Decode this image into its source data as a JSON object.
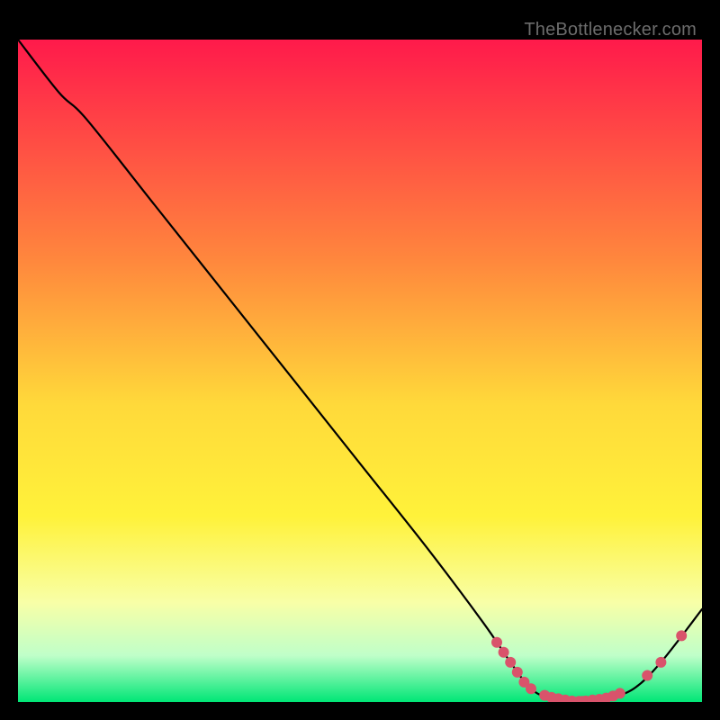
{
  "attribution": {
    "text": "TheBottlenecker.com"
  },
  "chart_data": {
    "type": "line",
    "title": "",
    "xlabel": "",
    "ylabel": "",
    "xlim": [
      0,
      100
    ],
    "ylim": [
      0,
      100
    ],
    "background_gradient": {
      "stops": [
        {
          "offset": 0,
          "color": "#ff1a4b"
        },
        {
          "offset": 0.33,
          "color": "#ff863d"
        },
        {
          "offset": 0.55,
          "color": "#ffd93a"
        },
        {
          "offset": 0.72,
          "color": "#fff23a"
        },
        {
          "offset": 0.85,
          "color": "#f8ffa7"
        },
        {
          "offset": 0.93,
          "color": "#bfffc9"
        },
        {
          "offset": 1.0,
          "color": "#00e676"
        }
      ]
    },
    "curve": [
      {
        "x": 0,
        "y": 100
      },
      {
        "x": 6,
        "y": 92
      },
      {
        "x": 10,
        "y": 88
      },
      {
        "x": 20,
        "y": 75
      },
      {
        "x": 30,
        "y": 62
      },
      {
        "x": 40,
        "y": 49
      },
      {
        "x": 50,
        "y": 36
      },
      {
        "x": 60,
        "y": 23
      },
      {
        "x": 68,
        "y": 12
      },
      {
        "x": 72,
        "y": 6
      },
      {
        "x": 75,
        "y": 2
      },
      {
        "x": 78,
        "y": 0.5
      },
      {
        "x": 82,
        "y": 0
      },
      {
        "x": 86,
        "y": 0.5
      },
      {
        "x": 90,
        "y": 2
      },
      {
        "x": 94,
        "y": 6
      },
      {
        "x": 100,
        "y": 14
      }
    ],
    "markers": [
      {
        "x": 70,
        "y": 9
      },
      {
        "x": 71,
        "y": 7.5
      },
      {
        "x": 72,
        "y": 6
      },
      {
        "x": 73,
        "y": 4.5
      },
      {
        "x": 74,
        "y": 3
      },
      {
        "x": 75,
        "y": 2
      },
      {
        "x": 77,
        "y": 1
      },
      {
        "x": 78,
        "y": 0.7
      },
      {
        "x": 79,
        "y": 0.5
      },
      {
        "x": 80,
        "y": 0.3
      },
      {
        "x": 81,
        "y": 0.15
      },
      {
        "x": 82,
        "y": 0.1
      },
      {
        "x": 82.5,
        "y": 0.1
      },
      {
        "x": 83,
        "y": 0.15
      },
      {
        "x": 84,
        "y": 0.3
      },
      {
        "x": 85,
        "y": 0.4
      },
      {
        "x": 86,
        "y": 0.6
      },
      {
        "x": 87,
        "y": 0.9
      },
      {
        "x": 88,
        "y": 1.3
      },
      {
        "x": 92,
        "y": 4
      },
      {
        "x": 94,
        "y": 6
      },
      {
        "x": 97,
        "y": 10
      }
    ],
    "marker_style": {
      "color": "#d9536b",
      "radius": 6
    },
    "line_style": {
      "color": "#000000",
      "width": 2.2
    }
  }
}
